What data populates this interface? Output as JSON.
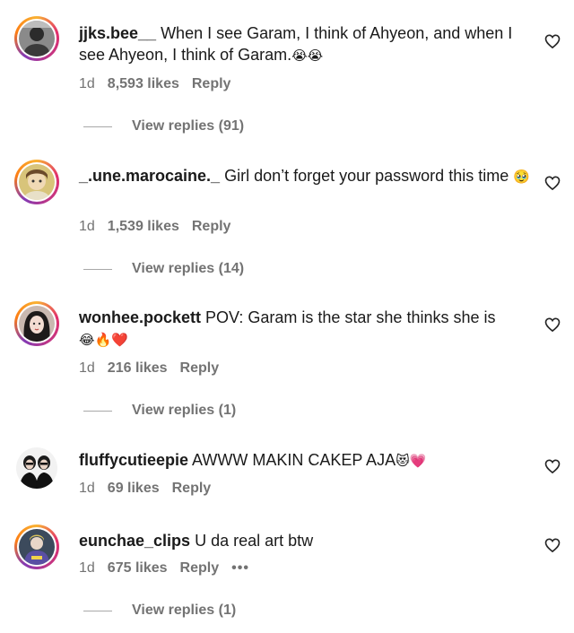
{
  "comments": [
    {
      "username": "jjks.bee__",
      "text": " When I see Garam, I think of Ahyeon, and when I see Ahyeon, I think of Garam.",
      "emoji": "😭😭",
      "age": "1d",
      "likes": "8,593 likes",
      "reply": "Reply",
      "view_replies": "View replies (91)"
    },
    {
      "username": "_.une.marocaine._",
      "text": " Girl don’t forget your password this time",
      "emoji": "🥹",
      "age": "1d",
      "likes": "1,539 likes",
      "reply": "Reply",
      "view_replies": "View replies (14)"
    },
    {
      "username": "wonhee.pockett",
      "text": " POV: Garam is the star she thinks she is",
      "emoji": "😂🔥❤️",
      "age": "1d",
      "likes": "216 likes",
      "reply": "Reply",
      "view_replies": "View replies (1)"
    },
    {
      "username": "fluffycutieepie",
      "text": " AWWW MAKIN CAKEP AJA",
      "emoji": "😻💗",
      "age": "1d",
      "likes": "69 likes",
      "reply": "Reply"
    },
    {
      "username": "eunchae_clips",
      "text": " U da real art btw",
      "emoji": "",
      "age": "1d",
      "likes": "675 likes",
      "reply": "Reply",
      "more": "•••",
      "view_replies": "View replies (1)"
    }
  ],
  "icons": {
    "like": "heart-outline-icon",
    "more": "more-options-icon"
  }
}
